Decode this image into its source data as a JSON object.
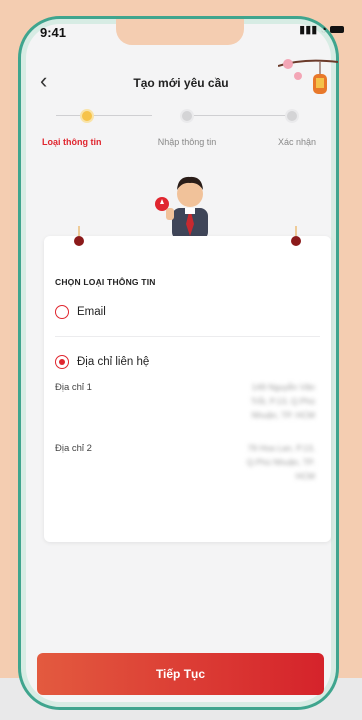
{
  "status_bar": {
    "time": "9:41"
  },
  "header": {
    "title": "Tạo mới yêu cầu"
  },
  "steps": [
    {
      "label": "Loại thông tin",
      "state": "active"
    },
    {
      "label": "Nhập thông tin",
      "state": "inactive"
    },
    {
      "label": "Xác nhận",
      "state": "inactive"
    }
  ],
  "form": {
    "section_title": "CHỌN LOẠI THÔNG TIN",
    "options": [
      {
        "label": "Email",
        "selected": false
      },
      {
        "label": "Địa chỉ liên hệ",
        "selected": true
      }
    ],
    "addresses": [
      {
        "label": "Địa chỉ 1",
        "value": "149 Nguyễn Văn Trỗi, P.13, Q.Phú Nhuận, TP. HCM"
      },
      {
        "label": "Địa chỉ 2",
        "value": "79 Hoa Lan, P.13, Q.Phú Nhuận, TP. HCM"
      }
    ]
  },
  "footer": {
    "continue_label": "Tiếp Tục"
  },
  "colors": {
    "accent": "#e0262f",
    "frame": "#3fa58e",
    "background": "#f4cdb1"
  },
  "icons": [
    "back-chevron-icon",
    "signal-icon",
    "wifi-icon",
    "battery-icon",
    "lantern-icon",
    "avatar-illustration"
  ]
}
